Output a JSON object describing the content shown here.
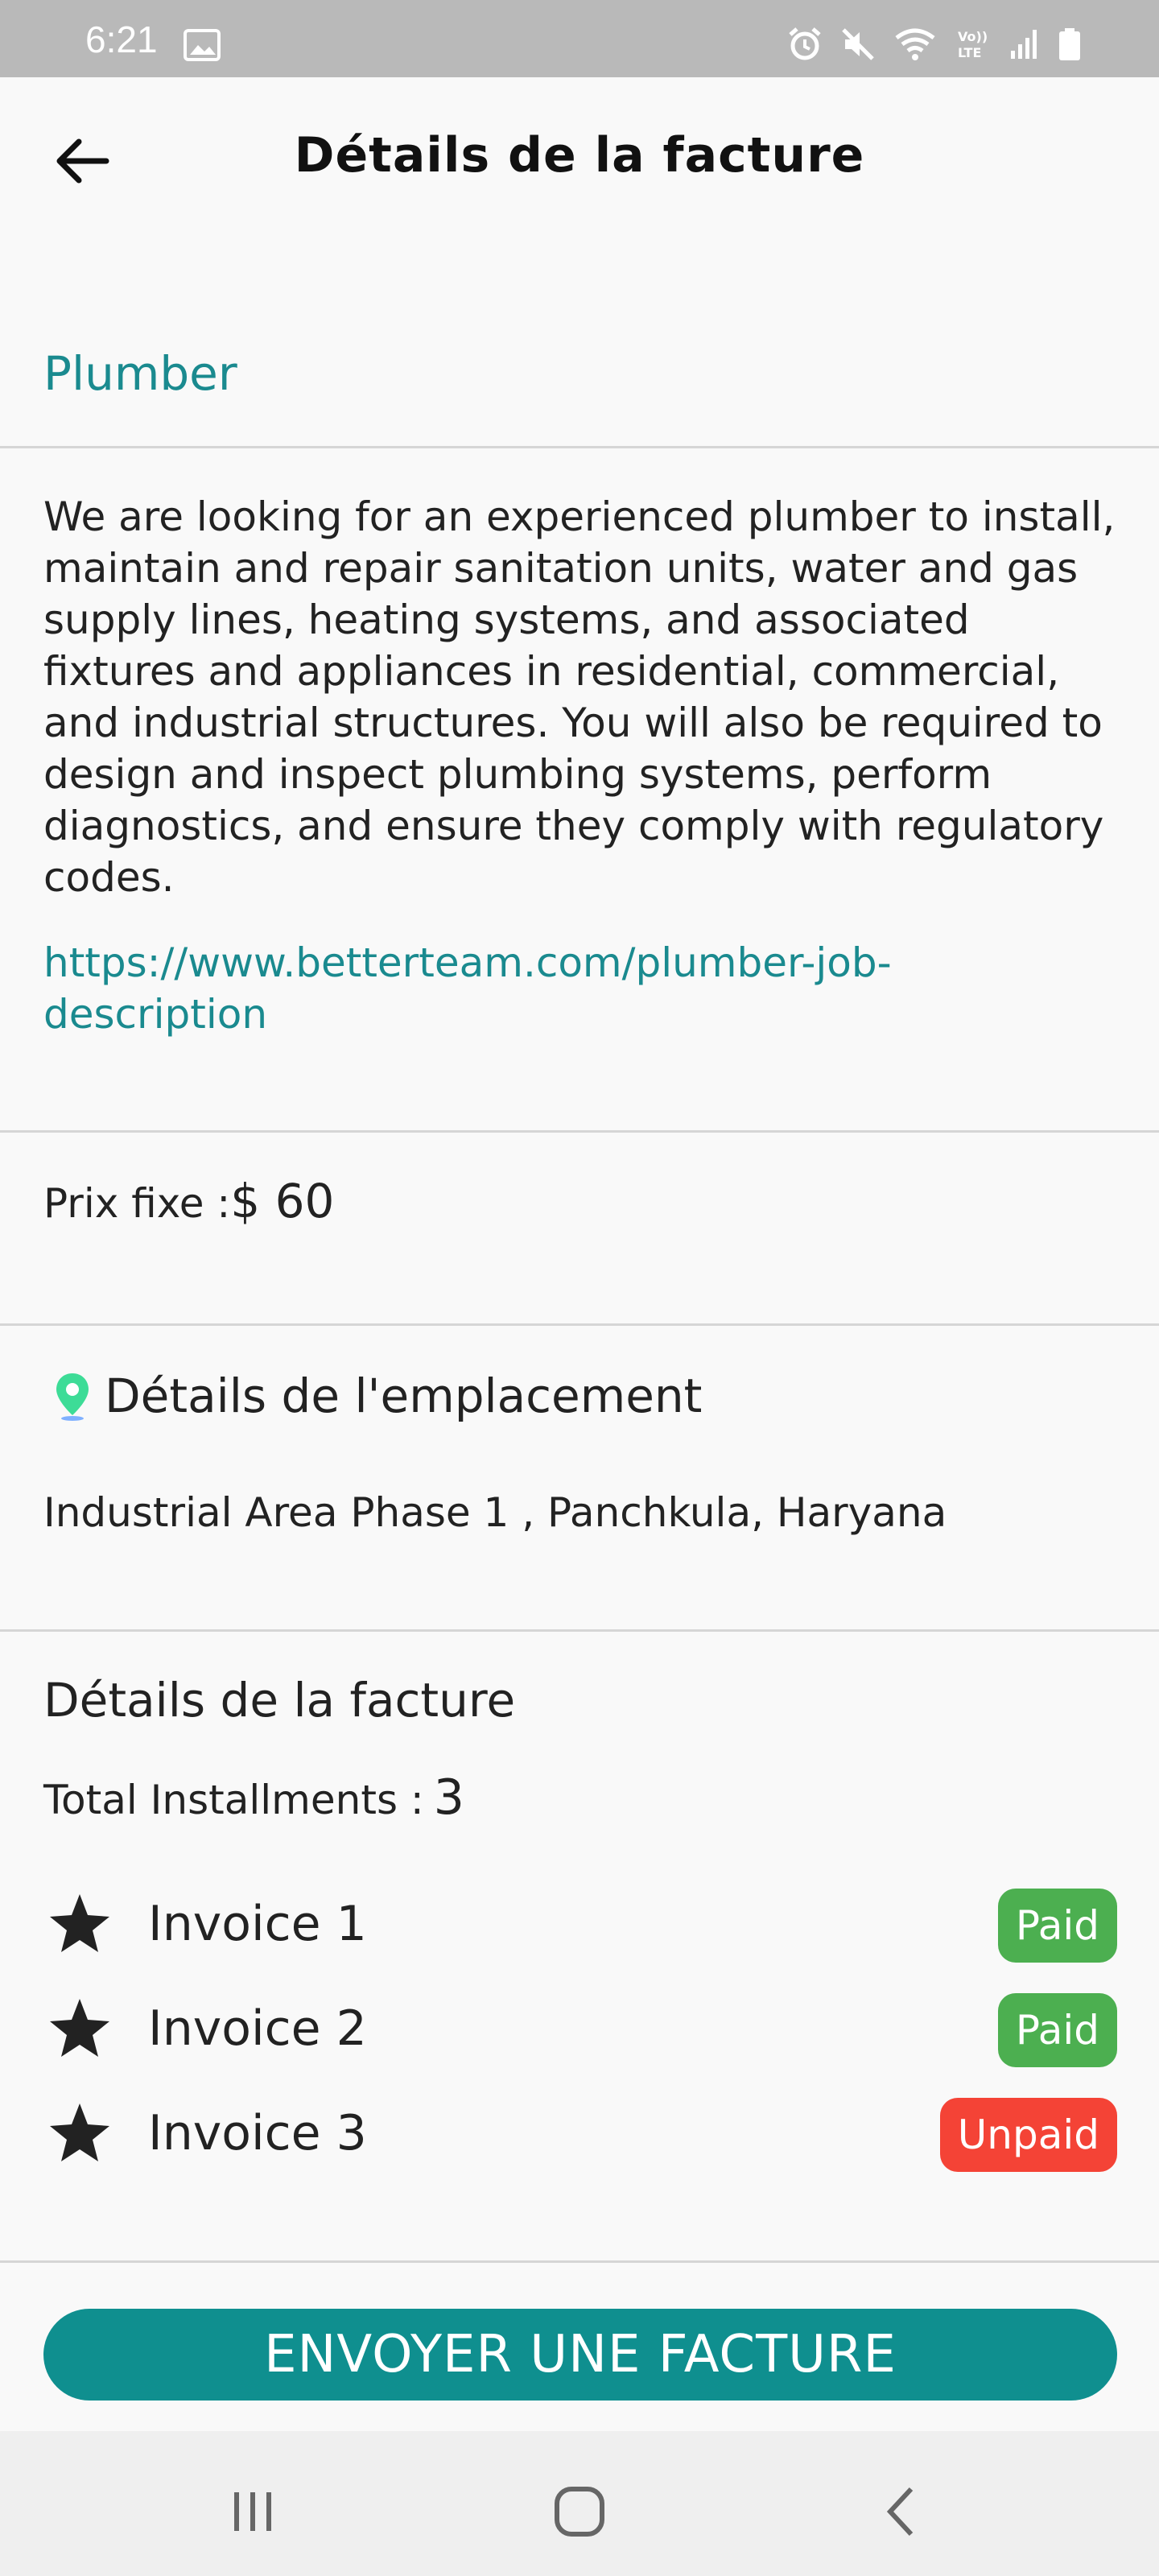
{
  "status_bar": {
    "time": "6:21",
    "icons": [
      "image-icon",
      "alarm-icon",
      "mute-icon",
      "wifi-icon",
      "volte-icon",
      "signal-icon",
      "battery-icon"
    ]
  },
  "header": {
    "title": "Détails de la facture",
    "back_icon": "arrow-left-icon"
  },
  "job": {
    "title": "Plumber",
    "description": "We are looking for an experienced plumber to install, maintain and repair sanitation units, water and gas supply lines, heating systems, and associated fixtures and appliances in residential, commercial, and industrial structures. You will also be required to design and inspect plumbing systems, perform diagnostics, and ensure they comply with regulatory codes.",
    "link": "https://www.betterteam.com/plumber-job-description"
  },
  "price": {
    "label": "Prix fixe :",
    "value": "$ 60"
  },
  "location": {
    "title": "Détails de l'emplacement",
    "address": "Industrial Area Phase 1 , Panchkula, Haryana",
    "icon": "location-pin-icon"
  },
  "invoice": {
    "title": "Détails de la facture",
    "installments_label": "Total Installments :",
    "installments_value": "3",
    "items": [
      {
        "label": "Invoice 1",
        "status": "Paid",
        "status_color": "#4caf50"
      },
      {
        "label": "Invoice 2",
        "status": "Paid",
        "status_color": "#4caf50"
      },
      {
        "label": "Invoice 3",
        "status": "Unpaid",
        "status_color": "#f44336"
      }
    ]
  },
  "send_button": {
    "label": "ENVOYER UNE FACTURE",
    "color": "#0f8f8f"
  },
  "nav": {
    "icons": [
      "recent-apps-icon",
      "home-icon",
      "back-icon"
    ]
  },
  "colors": {
    "accent": "#1a8a8f",
    "paid": "#4caf50",
    "unpaid": "#f44336"
  }
}
